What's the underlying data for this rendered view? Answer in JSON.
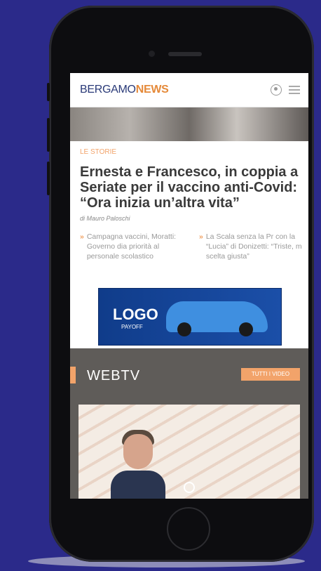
{
  "header": {
    "logo_part1": "BERGAMO",
    "logo_part2": "NEWS"
  },
  "article": {
    "kicker": "LE STORIE",
    "headline": "Ernesta e Francesco, in coppia a Seriate per il vaccino anti-Covid: “Ora inizia un’altra vita”",
    "byline": "di Mauro Paloschi"
  },
  "related": [
    {
      "text": "Campagna vaccini, Moratti: Governo dia priorità al personale scolastico"
    },
    {
      "text": "La Scala senza la Pr con la “Lucia” di Donizetti: “Triste, m scelta giusta”"
    }
  ],
  "ad": {
    "logo": "LOGO",
    "payoff": "PAYOFF"
  },
  "webtv": {
    "title": "WEBTV",
    "all_videos_label": "TUTTI I VIDEO"
  },
  "icons": {
    "user": "user-icon",
    "menu": "hamburger-menu-icon",
    "chevron": "double-chevron-right-icon",
    "play": "play-icon"
  },
  "colors": {
    "background": "#2b2a8a",
    "accent": "#f2a36a",
    "brand_blue": "#2a3a78"
  }
}
